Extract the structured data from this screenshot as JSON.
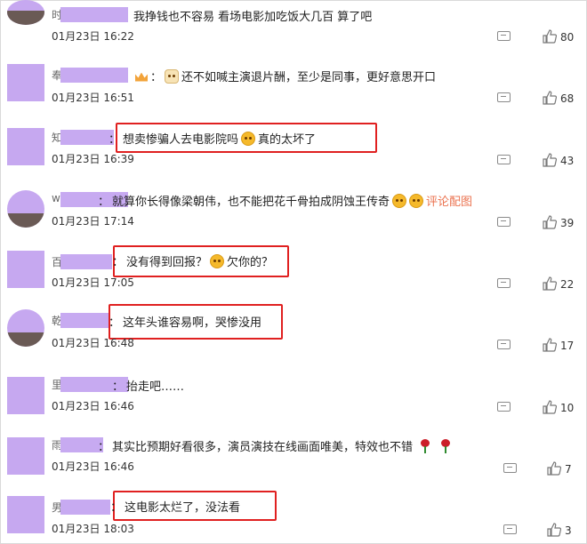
{
  "comments": [
    {
      "user_initial": "时",
      "text": "我挣钱也不容易 看场电影加吃饭大几百 算了吧",
      "time": "01月23日 16:22",
      "likes": "80"
    },
    {
      "user_initial": "奉",
      "colon": "：",
      "text": "还不如喊主演退片酬，至少是同事，更好意思开口",
      "time": "01月23日 16:51",
      "likes": "68"
    },
    {
      "user_initial": "知",
      "colon": "：",
      "text": "想卖惨骗人去电影院吗",
      "text2": "真的太坏了",
      "time": "01月23日 16:39",
      "likes": "43"
    },
    {
      "user_initial": "w",
      "colon": "：",
      "text": "就算你长得像梁朝伟，也不能把花千骨拍成阴蚀王传奇",
      "link": "评论配图",
      "time": "01月23日 17:14",
      "likes": "39"
    },
    {
      "user_initial": "百",
      "colon": "：",
      "text": "没有得到回报？",
      "text2": "欠你的？",
      "time": "01月23日 17:05",
      "likes": "22"
    },
    {
      "user_initial": "乾",
      "colon": "：",
      "text": "这年头谁容易啊，哭惨没用",
      "time": "01月23日 16:48",
      "likes": "17"
    },
    {
      "user_initial": "里",
      "colon": "：",
      "text": "抬走吧……",
      "time": "01月23日 16:46",
      "likes": "10"
    },
    {
      "user_initial": "雨",
      "colon": "：",
      "text": "其实比预期好看很多，演员演技在线画面唯美，特效也不错",
      "time": "01月23日 16:46",
      "likes": "7"
    },
    {
      "user_initial": "男",
      "colon": "：",
      "text": "这电影太烂了，没法看",
      "time": "01月23日 18:03",
      "likes": "3"
    }
  ],
  "icons": {
    "comment": "comment-icon",
    "like": "thumbs-up-icon",
    "emoji": "emoji-icon",
    "rose": "rose-icon",
    "crown": "crown-icon"
  },
  "colors": {
    "highlight": "#e02020",
    "blur": "#c7aaf1",
    "link": "#eb7350"
  }
}
